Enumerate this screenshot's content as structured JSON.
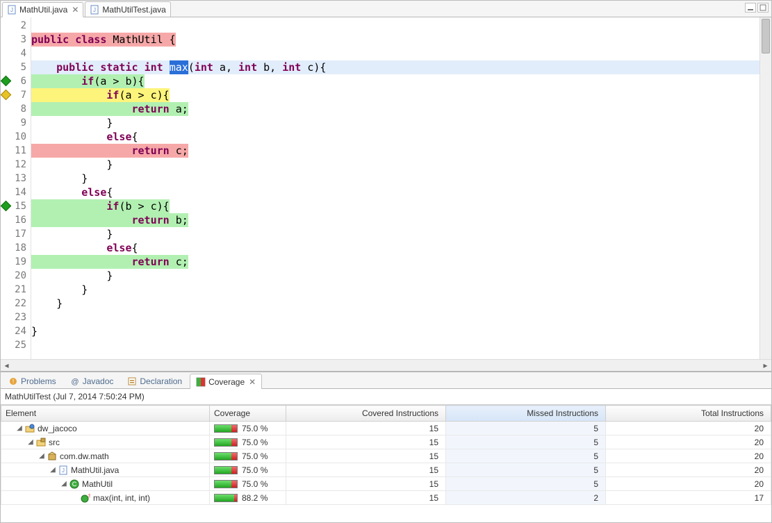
{
  "editor": {
    "tabs": [
      {
        "label": "MathUtil.java",
        "active": true
      },
      {
        "label": "MathUtilTest.java",
        "active": false
      }
    ],
    "lines": [
      {
        "n": 2,
        "text": "",
        "bg": null,
        "marker": null
      },
      {
        "n": 3,
        "tokens": [
          [
            "kw",
            "public"
          ],
          [
            "pln",
            " "
          ],
          [
            "kw",
            "class"
          ],
          [
            "pln",
            " MathUtil {"
          ]
        ],
        "bg": "red",
        "marker": null
      },
      {
        "n": 4,
        "text": "",
        "bg": null
      },
      {
        "n": 5,
        "tokens": [
          [
            "pln",
            "    "
          ],
          [
            "kw",
            "public"
          ],
          [
            "pln",
            " "
          ],
          [
            "kw",
            "static"
          ],
          [
            "pln",
            " "
          ],
          [
            "kw",
            "int"
          ],
          [
            "pln",
            " "
          ],
          [
            "sel",
            "max"
          ],
          [
            "pln",
            "("
          ],
          [
            "kw",
            "int"
          ],
          [
            "pln",
            " a, "
          ],
          [
            "kw",
            "int"
          ],
          [
            "pln",
            " b, "
          ],
          [
            "kw",
            "int"
          ],
          [
            "pln",
            " c){"
          ]
        ],
        "bg": "blue",
        "marker": null
      },
      {
        "n": 6,
        "tokens": [
          [
            "pln",
            "        "
          ],
          [
            "kw",
            "if"
          ],
          [
            "pln",
            "(a > b){"
          ]
        ],
        "bg": "green",
        "marker": "green"
      },
      {
        "n": 7,
        "tokens": [
          [
            "pln",
            "            "
          ],
          [
            "kw",
            "if"
          ],
          [
            "pln",
            "(a > c){"
          ]
        ],
        "bg": "yellow",
        "marker": "yellow"
      },
      {
        "n": 8,
        "tokens": [
          [
            "pln",
            "                "
          ],
          [
            "kw",
            "return"
          ],
          [
            "pln",
            " a;"
          ]
        ],
        "bg": "green"
      },
      {
        "n": 9,
        "tokens": [
          [
            "pln",
            "            }"
          ]
        ],
        "bg": null
      },
      {
        "n": 10,
        "tokens": [
          [
            "pln",
            "            "
          ],
          [
            "kw",
            "else"
          ],
          [
            "pln",
            "{"
          ]
        ]
      },
      {
        "n": 11,
        "tokens": [
          [
            "pln",
            "                "
          ],
          [
            "kw",
            "return"
          ],
          [
            "pln",
            " c;"
          ]
        ],
        "bg": "red"
      },
      {
        "n": 12,
        "tokens": [
          [
            "pln",
            "            }"
          ]
        ]
      },
      {
        "n": 13,
        "tokens": [
          [
            "pln",
            "        }"
          ]
        ]
      },
      {
        "n": 14,
        "tokens": [
          [
            "pln",
            "        "
          ],
          [
            "kw",
            "else"
          ],
          [
            "pln",
            "{"
          ]
        ]
      },
      {
        "n": 15,
        "tokens": [
          [
            "pln",
            "            "
          ],
          [
            "kw",
            "if"
          ],
          [
            "pln",
            "(b > c){"
          ]
        ],
        "bg": "green",
        "marker": "green"
      },
      {
        "n": 16,
        "tokens": [
          [
            "pln",
            "                "
          ],
          [
            "kw",
            "return"
          ],
          [
            "pln",
            " b;"
          ]
        ],
        "bg": "green"
      },
      {
        "n": 17,
        "tokens": [
          [
            "pln",
            "            }"
          ]
        ]
      },
      {
        "n": 18,
        "tokens": [
          [
            "pln",
            "            "
          ],
          [
            "kw",
            "else"
          ],
          [
            "pln",
            "{"
          ]
        ]
      },
      {
        "n": 19,
        "tokens": [
          [
            "pln",
            "                "
          ],
          [
            "kw",
            "return"
          ],
          [
            "pln",
            " c;"
          ]
        ],
        "bg": "green"
      },
      {
        "n": 20,
        "tokens": [
          [
            "pln",
            "            }"
          ]
        ]
      },
      {
        "n": 21,
        "tokens": [
          [
            "pln",
            "        }"
          ]
        ]
      },
      {
        "n": 22,
        "tokens": [
          [
            "pln",
            "    }"
          ]
        ]
      },
      {
        "n": 23,
        "text": ""
      },
      {
        "n": 24,
        "tokens": [
          [
            "pln",
            "}"
          ]
        ]
      },
      {
        "n": 25,
        "text": ""
      }
    ]
  },
  "views": {
    "tabs": [
      {
        "label": "Problems",
        "icon": "problems"
      },
      {
        "label": "Javadoc",
        "icon": "javadoc"
      },
      {
        "label": "Declaration",
        "icon": "declaration"
      },
      {
        "label": "Coverage",
        "icon": "coverage",
        "active": true
      }
    ],
    "coverage_title": "MathUtilTest (Jul 7, 2014 7:50:24 PM)",
    "columns": {
      "element": "Element",
      "coverage": "Coverage",
      "covered": "Covered Instructions",
      "missed": "Missed Instructions",
      "total": "Total Instructions"
    },
    "rows": [
      {
        "depth": 0,
        "expand": true,
        "icon": "project",
        "label": "dw_jacoco",
        "pct": 75.0,
        "cov": 15,
        "miss": 5,
        "tot": 20
      },
      {
        "depth": 1,
        "expand": true,
        "icon": "srcfolder",
        "label": "src",
        "pct": 75.0,
        "cov": 15,
        "miss": 5,
        "tot": 20
      },
      {
        "depth": 2,
        "expand": true,
        "icon": "package",
        "label": "com.dw.math",
        "pct": 75.0,
        "cov": 15,
        "miss": 5,
        "tot": 20
      },
      {
        "depth": 3,
        "expand": true,
        "icon": "javafile",
        "label": "MathUtil.java",
        "pct": 75.0,
        "cov": 15,
        "miss": 5,
        "tot": 20
      },
      {
        "depth": 4,
        "expand": true,
        "icon": "class",
        "label": "MathUtil",
        "pct": 75.0,
        "cov": 15,
        "miss": 5,
        "tot": 20
      },
      {
        "depth": 5,
        "expand": false,
        "icon": "method",
        "label": "max(int, int, int)",
        "pct": 88.2,
        "cov": 15,
        "miss": 2,
        "tot": 17
      }
    ]
  }
}
